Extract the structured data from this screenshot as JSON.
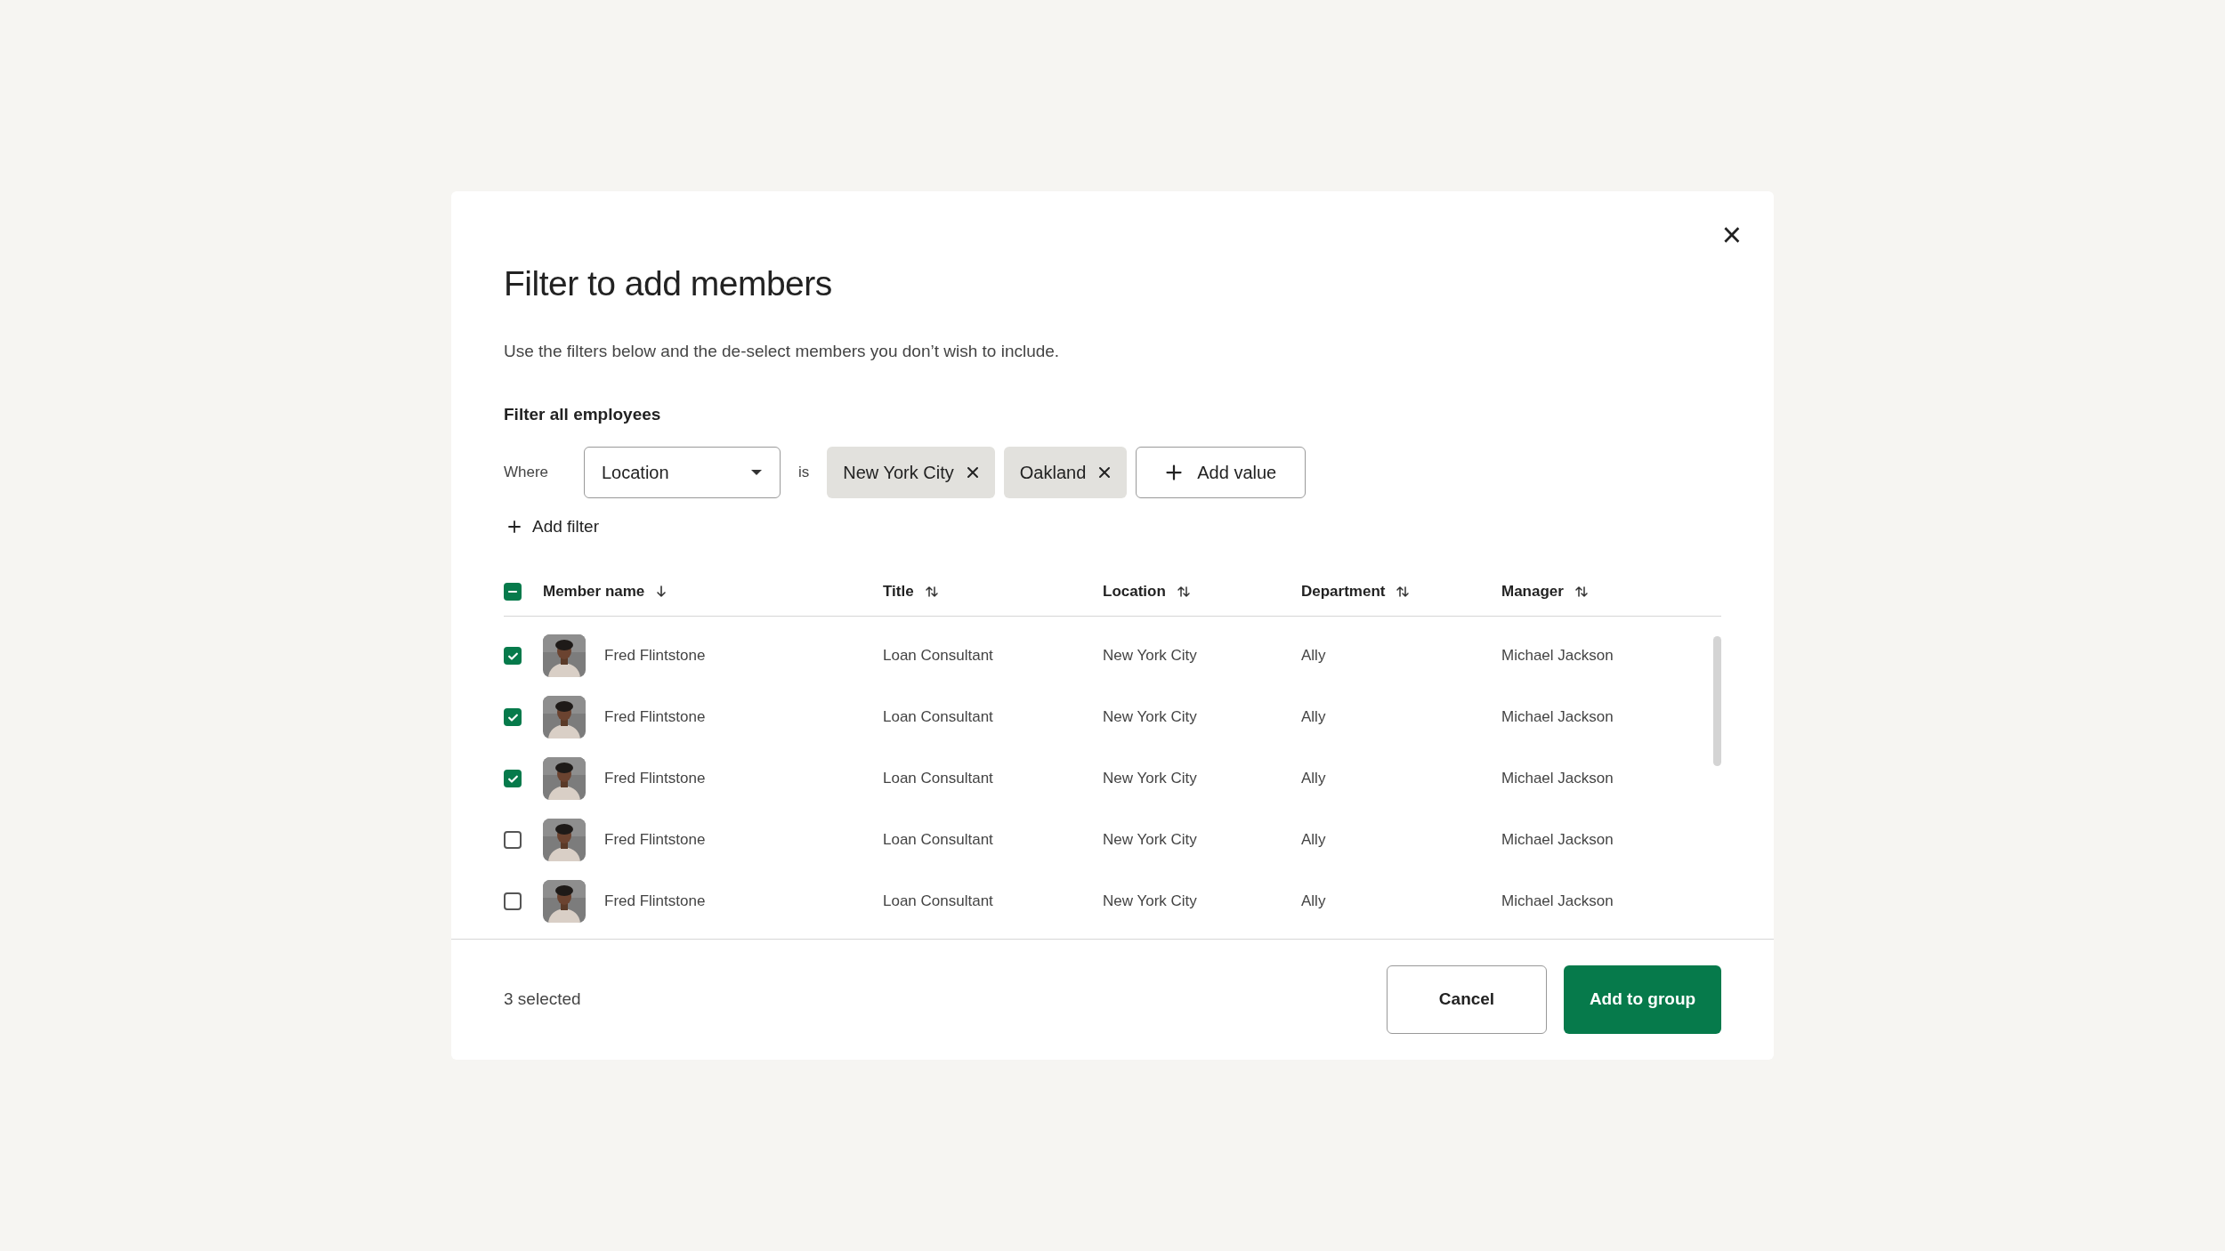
{
  "dialog": {
    "title": "Filter to add members",
    "description": "Use the filters below and the de-select members you don’t wish to include.",
    "close": "×"
  },
  "filter": {
    "heading": "Filter all employees",
    "where_label": "Where",
    "field": "Location",
    "operator": "is",
    "values": [
      {
        "label": "New York City"
      },
      {
        "label": "Oakland"
      }
    ],
    "add_value": "Add value",
    "add_filter": "Add filter"
  },
  "table": {
    "select_all": {
      "checked": true,
      "indeterminate": true
    },
    "columns": [
      {
        "label": "Member name",
        "sorted": true
      },
      {
        "label": "Title",
        "sorted": false
      },
      {
        "label": "Location",
        "sorted": false
      },
      {
        "label": "Department",
        "sorted": false
      },
      {
        "label": "Manager",
        "sorted": false
      }
    ],
    "rows": [
      {
        "checked": true,
        "name": "Fred Flintstone",
        "title": "Loan Consultant",
        "location": "New York City",
        "department": "Ally",
        "manager": "Michael Jackson"
      },
      {
        "checked": true,
        "name": "Fred Flintstone",
        "title": "Loan Consultant",
        "location": "New York City",
        "department": "Ally",
        "manager": "Michael Jackson"
      },
      {
        "checked": true,
        "name": "Fred Flintstone",
        "title": "Loan Consultant",
        "location": "New York City",
        "department": "Ally",
        "manager": "Michael Jackson"
      },
      {
        "checked": false,
        "name": "Fred Flintstone",
        "title": "Loan Consultant",
        "location": "New York City",
        "department": "Ally",
        "manager": "Michael Jackson"
      },
      {
        "checked": false,
        "name": "Fred Flintstone",
        "title": "Loan Consultant",
        "location": "New York City",
        "department": "Ally",
        "manager": "Michael Jackson"
      }
    ]
  },
  "footer": {
    "selected_count": "3 selected",
    "cancel": "Cancel",
    "confirm": "Add to group"
  }
}
